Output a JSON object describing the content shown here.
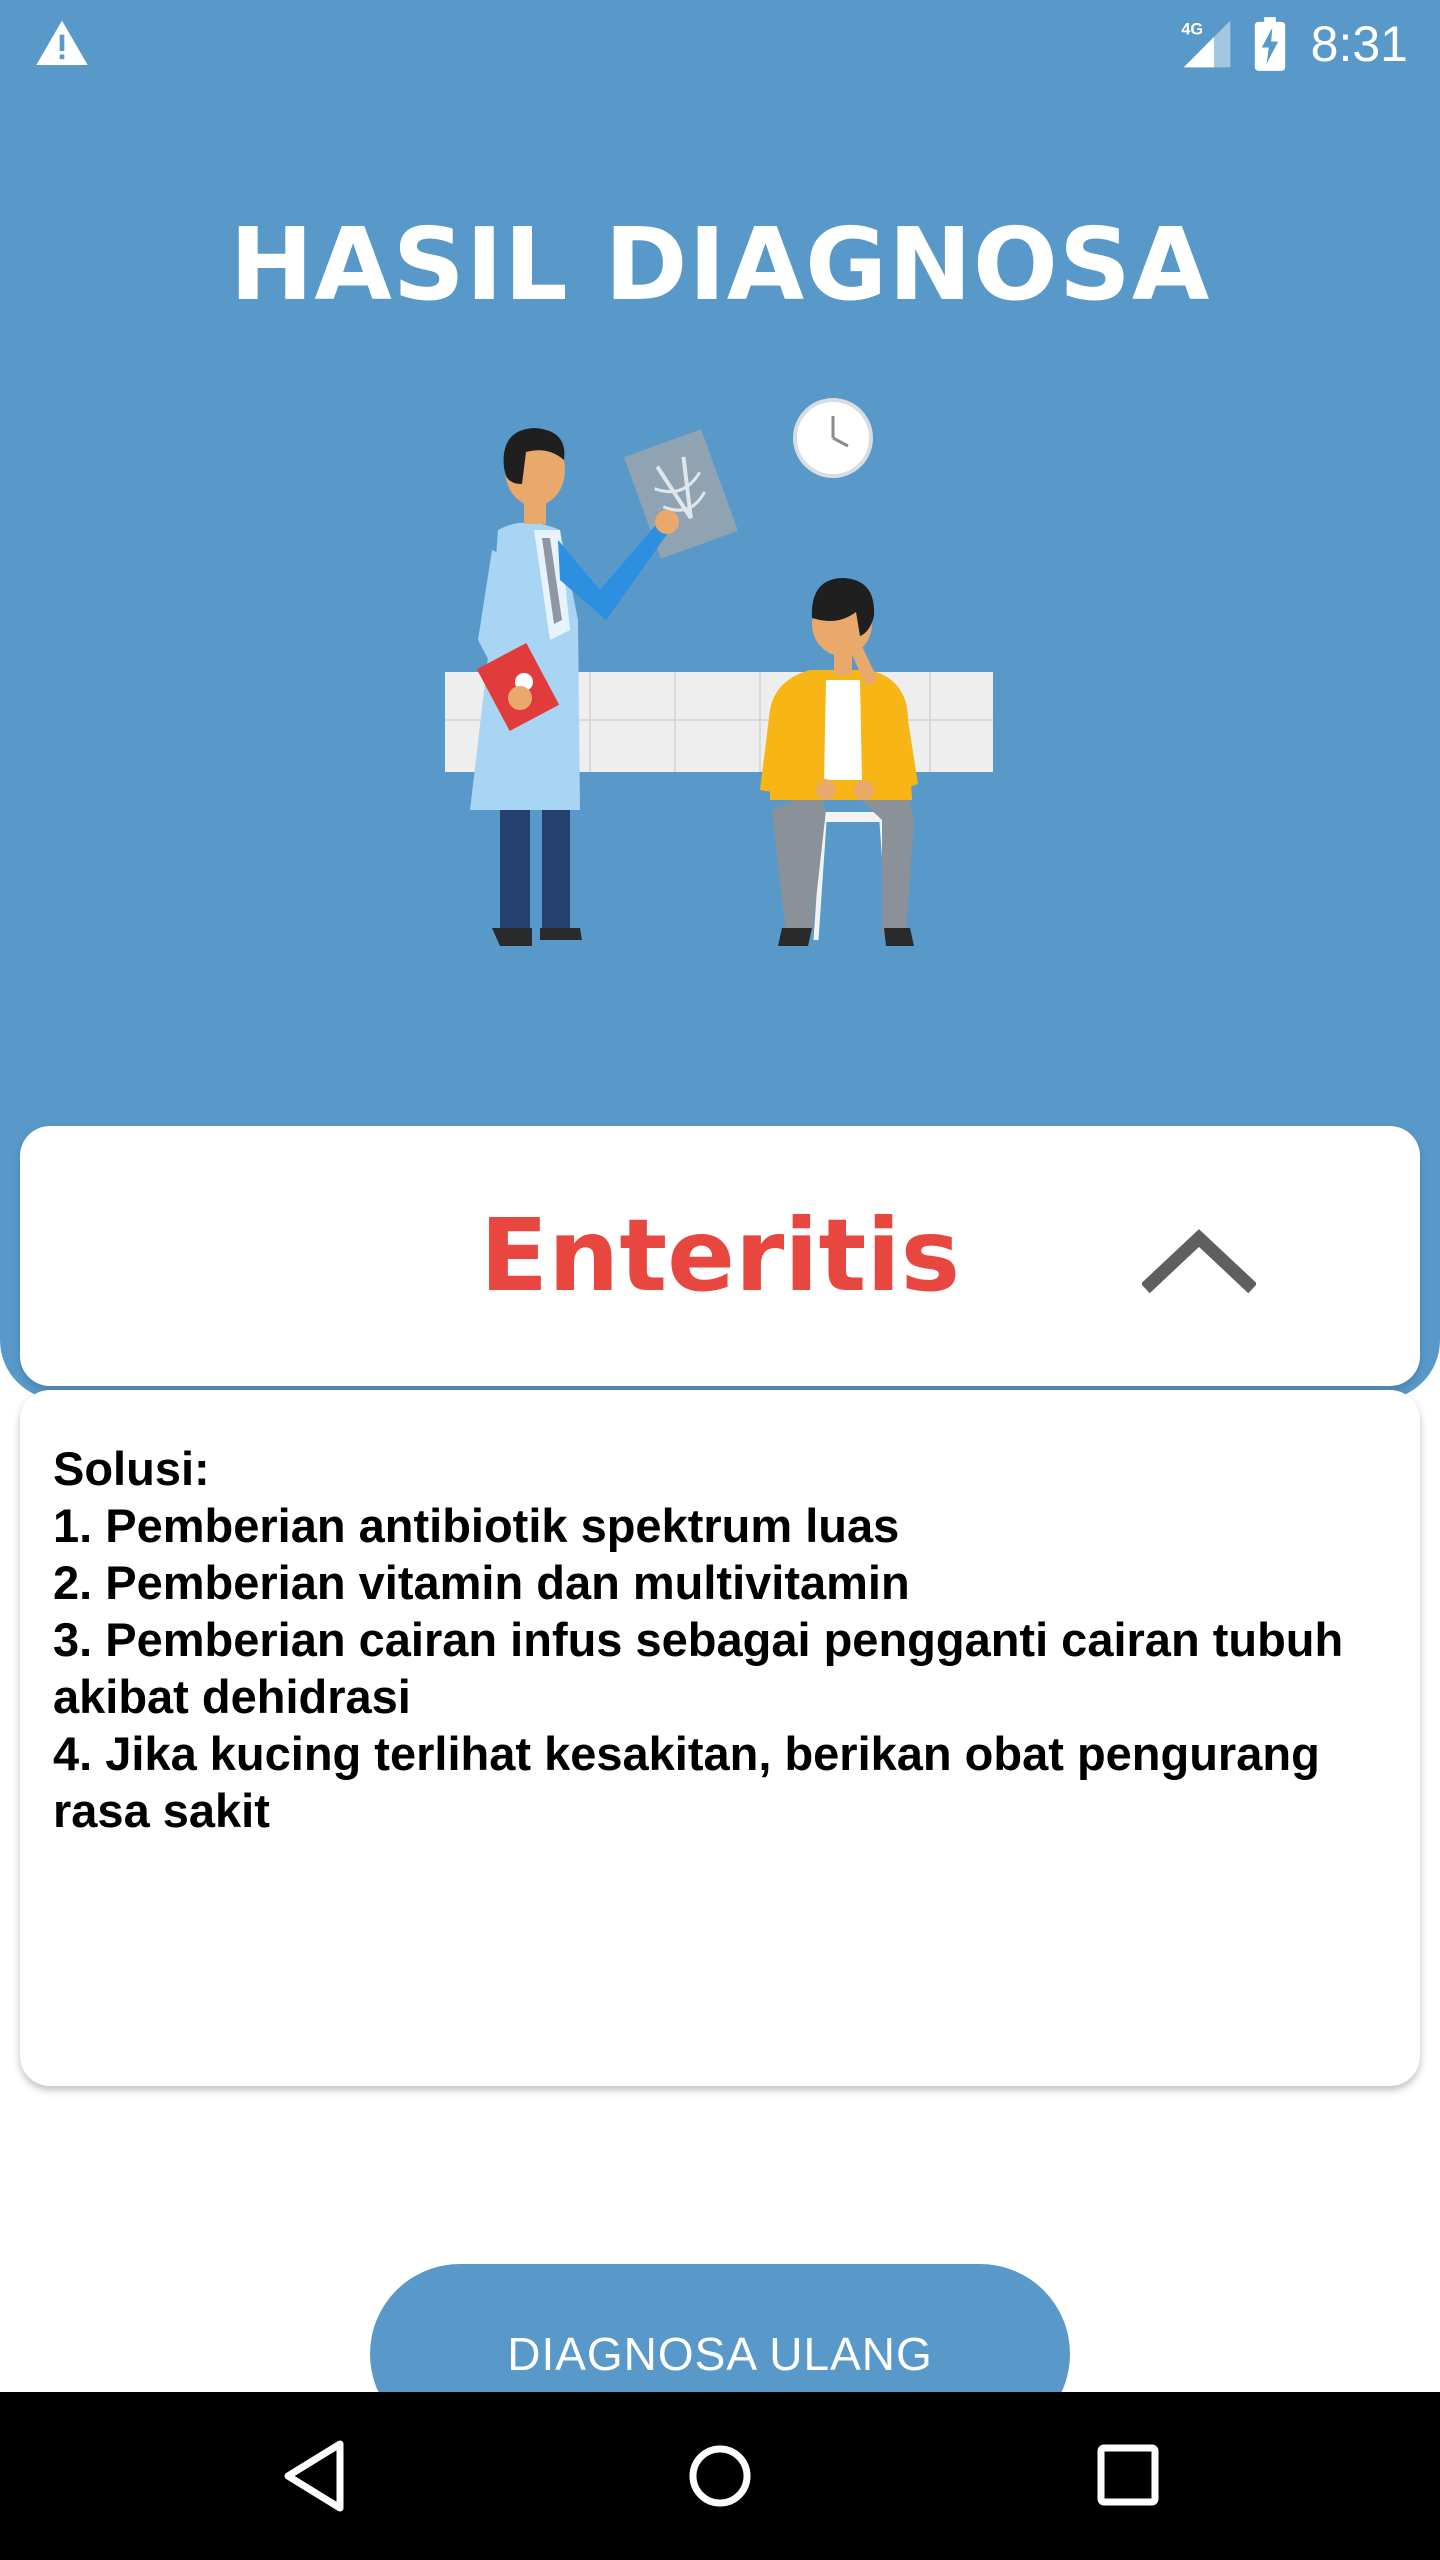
{
  "status_bar": {
    "network": "4G",
    "time": "8:31",
    "icons": [
      "warning-icon",
      "signal-icon",
      "battery-charging-icon"
    ]
  },
  "header": {
    "title": "HASIL DIAGNOSA",
    "background_color": "#5899c9"
  },
  "result": {
    "disease_name": "Enteritis",
    "name_color": "#e8473f",
    "toggle_icon": "chevron-up-icon"
  },
  "solution": {
    "lines": [
      "Solusi:",
      "1. Pemberian antibiotik spektrum luas",
      "2. Pemberian vitamin dan multivitamin",
      "3. Pemberian cairan infus sebagai pengganti cairan tubuh akibat dehidrasi",
      "4. Jika kucing terlihat kesakitan, berikan obat pengurang rasa sakit"
    ]
  },
  "actions": {
    "rediagnose_label": "DIAGNOSA ULANG",
    "button_color": "#5899c9"
  },
  "nav_bar": {
    "icons": [
      "back-icon",
      "home-icon",
      "recent-apps-icon"
    ]
  }
}
